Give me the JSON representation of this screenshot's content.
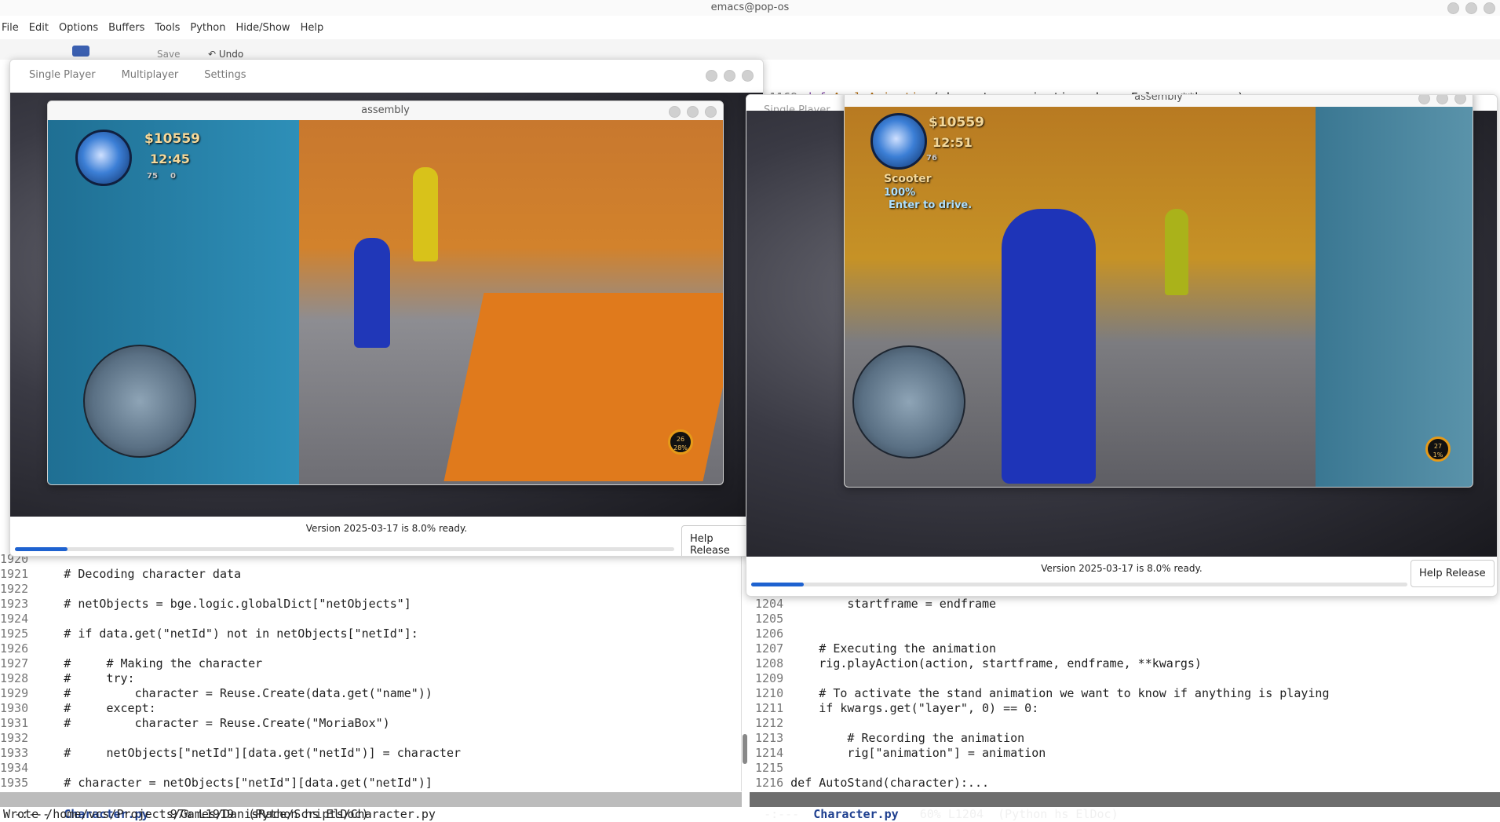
{
  "window": {
    "title": "emacs@pop-os"
  },
  "menu": [
    "File",
    "Edit",
    "Options",
    "Buffers",
    "Tools",
    "Python",
    "Hide/Show",
    "Help"
  ],
  "toolbar": {
    "save_label": "Save",
    "undo_label": "Undo"
  },
  "left_pane": {
    "lines": [
      {
        "n": "1920",
        "t": ""
      },
      {
        "n": "1921",
        "t": "    # Decoding character data"
      },
      {
        "n": "1922",
        "t": ""
      },
      {
        "n": "1923",
        "t": "    # netObjects = bge.logic.globalDict[\"netObjects\"]"
      },
      {
        "n": "1924",
        "t": ""
      },
      {
        "n": "1925",
        "t": "    # if data.get(\"netId\") not in netObjects[\"netId\"]:"
      },
      {
        "n": "1926",
        "t": ""
      },
      {
        "n": "1927",
        "t": "    #     # Making the character"
      },
      {
        "n": "1928",
        "t": "    #     try:"
      },
      {
        "n": "1929",
        "t": "    #         character = Reuse.Create(data.get(\"name\"))"
      },
      {
        "n": "1930",
        "t": "    #     except:"
      },
      {
        "n": "1931",
        "t": "    #         character = Reuse.Create(\"MoriaBox\")"
      },
      {
        "n": "1932",
        "t": ""
      },
      {
        "n": "1933",
        "t": "    #     netObjects[\"netId\"][data.get(\"netId\")] = character"
      },
      {
        "n": "1934",
        "t": ""
      },
      {
        "n": "1935",
        "t": "    # character = netObjects[\"netId\"][data.get(\"netId\")]"
      }
    ],
    "modeline": {
      "prefix": "-:---  ",
      "buffer": "Character.py",
      "info": "   97% L1919  (Python hs ElDoc)"
    }
  },
  "right_pane": {
    "top_line": {
      "n": "1169",
      "kw": "def",
      "fn": "ApplyAnimation",
      "rest": "(character, animation, keep=False, **kwargs):"
    },
    "lines": [
      {
        "n": "1204",
        "t": "        startframe = endframe"
      },
      {
        "n": "1205",
        "t": ""
      },
      {
        "n": "1206",
        "t": ""
      },
      {
        "n": "1207",
        "t": "    # Executing the animation"
      },
      {
        "n": "1208",
        "t": "    rig.playAction(action, startframe, endframe, **kwargs)"
      },
      {
        "n": "1209",
        "t": ""
      },
      {
        "n": "1210",
        "t": "    # To activate the stand animation we want to know if anything is playing"
      },
      {
        "n": "1211",
        "t": "    if kwargs.get(\"layer\", 0) == 0:"
      },
      {
        "n": "1212",
        "t": ""
      },
      {
        "n": "1213",
        "t": "        # Recording the animation"
      },
      {
        "n": "1214",
        "t": "        rig[\"animation\"] = animation"
      },
      {
        "n": "1215",
        "t": ""
      },
      {
        "n": "1216",
        "t": "def AutoStand(character):..."
      }
    ],
    "modeline": {
      "prefix": "-:---  ",
      "buffer": "Character.py",
      "info": "   60% L1204  (Python hs ElDoc)"
    }
  },
  "echo_area": "Wrote /home/vcs/Projects/Games/DanisRace/Scripts/Character.py",
  "launcher_left": {
    "tabs": [
      "Single Player",
      "Multiplayer",
      "Settings"
    ],
    "game_title": "assembly",
    "hud": {
      "money": "$10559",
      "time": "12:45",
      "stats_a": "75",
      "stats_b": "0",
      "speed": "26",
      "speed_unit": "28%"
    },
    "status": "Version 2025-03-17 is 8.0% ready.",
    "progress": 0.08,
    "help_button": "Help Release"
  },
  "launcher_right": {
    "tabs": [
      "Single Player"
    ],
    "game_title": "assembly",
    "hud": {
      "money": "$10559",
      "time": "12:51",
      "stats_a": "76",
      "vehicle": "Scooter",
      "vehicle_pct": "100%",
      "prompt": "Enter to drive.",
      "speed": "27",
      "speed_unit": "1%"
    },
    "status": "Version 2025-03-17 is 8.0% ready.",
    "progress": 0.08,
    "help_button": "Help Release"
  }
}
